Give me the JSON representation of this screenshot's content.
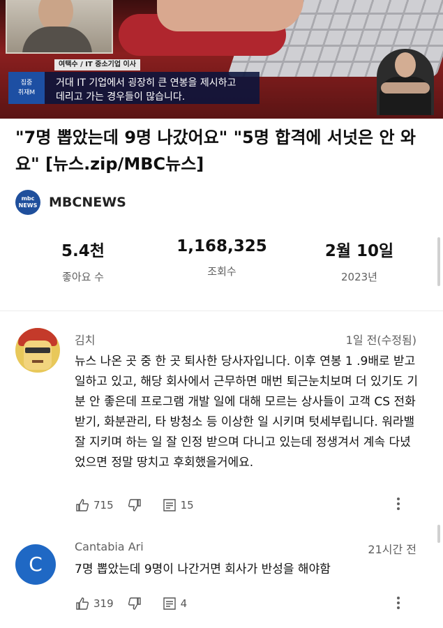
{
  "video": {
    "interviewee_caption": "여택수 / IT 중소기업 이사",
    "tag_line1": "집중",
    "tag_line2": "취재M",
    "subtitle_line1": "거대 IT 기업에서 굉장히 큰 연봉을 제시하고",
    "subtitle_line2": "데리고 가는 경우들이 많습니다."
  },
  "title": "\"7명 뽑았는데 9명 나갔어요\" \"5명 합격에 서넛은 안 와요\" [뉴스.zip/MBC뉴스]",
  "channel": {
    "logo_line1": "mbc",
    "logo_line2": "NEWS",
    "name": "MBCNEWS"
  },
  "stats": {
    "likes_value": "5.4천",
    "likes_label": "좋아요 수",
    "views_value": "1,168,325",
    "views_label": "조회수",
    "date_value": "2월 10일",
    "date_label": "2023년"
  },
  "comments": [
    {
      "author": "김치",
      "time": "1일 전(수정됨)",
      "text": "뉴스 나온 곳 중 한 곳 퇴사한 당사자입니다. 이후 연봉 1 .9배로 받고 일하고 있고, 해당 회사에서 근무하면 매번 퇴근눈치보며 더 있기도 기분 안 좋은데 프로그램 개발 일에 대해 모르는 상사들이 고객 CS 전화받기, 화분관리, 타 방청소 등 이상한 일 시키며 텃세부립니다. 워라밸 잘 지키며 하는 일 잘 인정 받으며 다니고 있는데 정생겨서 계속 다녔었으면 정말 땅치고 후회했을거에요.",
      "likes": "715",
      "replies": "15"
    },
    {
      "author": "Cantabia Ari",
      "avatar_letter": "C",
      "time": "21시간 전",
      "text": "7명 뽑았는데 9명이 나간거면 회사가 반성을 해야함",
      "likes": "319",
      "replies": "4"
    }
  ],
  "icons": [
    "thumbs-up-icon",
    "thumbs-down-icon",
    "replies-icon",
    "more-options-icon"
  ],
  "colors": {
    "avatar_blue": "#1f68c4",
    "mbc_blue": "#1f4f9c",
    "muted_text": "#606060"
  }
}
